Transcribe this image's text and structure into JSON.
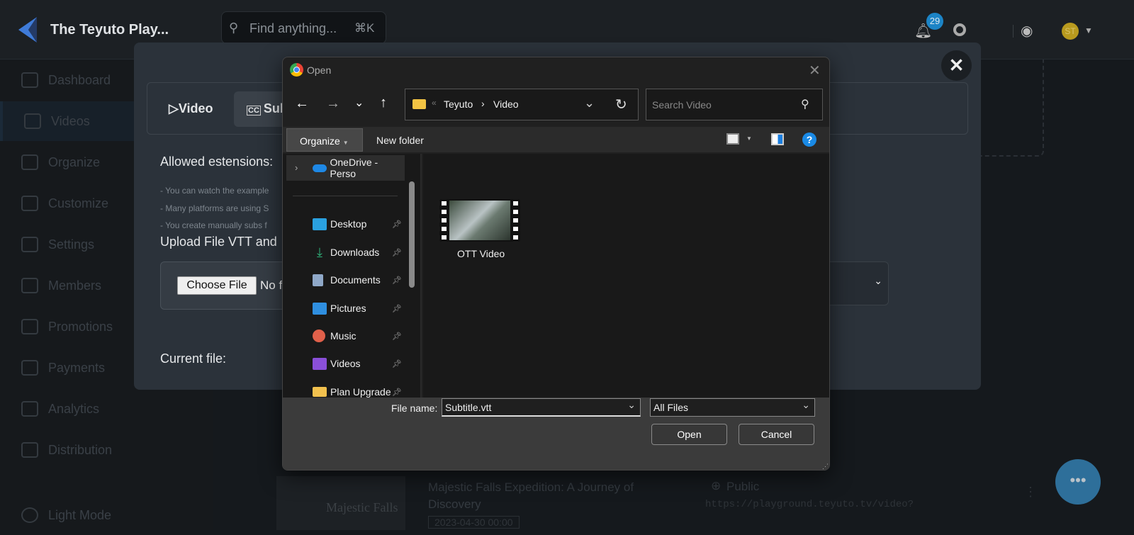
{
  "header": {
    "app_title": "The Teyuto Play...",
    "search_placeholder": "Find anything...",
    "search_shortcut": "⌘K",
    "notification_count": "29",
    "avatar_initials": "ST"
  },
  "sidebar": {
    "items": [
      {
        "label": "Dashboard"
      },
      {
        "label": "Videos"
      },
      {
        "label": "Organize"
      },
      {
        "label": "Customize"
      },
      {
        "label": "Settings"
      },
      {
        "label": "Members"
      },
      {
        "label": "Promotions"
      },
      {
        "label": "Payments"
      },
      {
        "label": "Analytics"
      },
      {
        "label": "Distribution"
      }
    ],
    "light_mode": "Light Mode"
  },
  "modal": {
    "tabs": [
      {
        "label": "Video"
      },
      {
        "label": "Sub"
      }
    ],
    "allowed_heading": "Allowed estensions:",
    "bullets": [
      "- You can watch the example",
      "- Many platforms are using S",
      "- You create manually subs f"
    ],
    "upload_heading": "Upload File VTT and",
    "choose_file": "Choose File",
    "no_file": "No f",
    "current_file": "Current file:"
  },
  "video_row": {
    "thumb_text": "Majestic Falls",
    "title": "Majestic Falls Expedition: A Journey of Discovery",
    "visibility": "Public",
    "url": "https://playground.teyuto.tv/video?",
    "date": "2023-04-30 00:00"
  },
  "dialog": {
    "title": "Open",
    "breadcrumb": [
      "Teyuto",
      "Video"
    ],
    "search_placeholder": "Search Video",
    "organize": "Organize",
    "new_folder": "New folder",
    "nav": [
      {
        "label": "OneDrive - Perso",
        "color": "#1e88e5"
      },
      {
        "label": "Desktop",
        "color": "#2aa1e0",
        "pinned": true
      },
      {
        "label": "Downloads",
        "color": "#2fb37a",
        "pinned": true
      },
      {
        "label": "Documents",
        "color": "#8fa8c8",
        "pinned": true
      },
      {
        "label": "Pictures",
        "color": "#2f8fe0",
        "pinned": true
      },
      {
        "label": "Music",
        "color": "#e0604a",
        "pinned": true
      },
      {
        "label": "Videos",
        "color": "#8a4fd8",
        "pinned": true
      },
      {
        "label": "Plan Upgrade",
        "color": "#f2c14e",
        "pinned": true
      }
    ],
    "files": [
      {
        "name": "OTT Video"
      }
    ],
    "file_name_label": "File name:",
    "file_name_value": "Subtitle.vtt",
    "file_type": "All Files",
    "open": "Open",
    "cancel": "Cancel"
  }
}
